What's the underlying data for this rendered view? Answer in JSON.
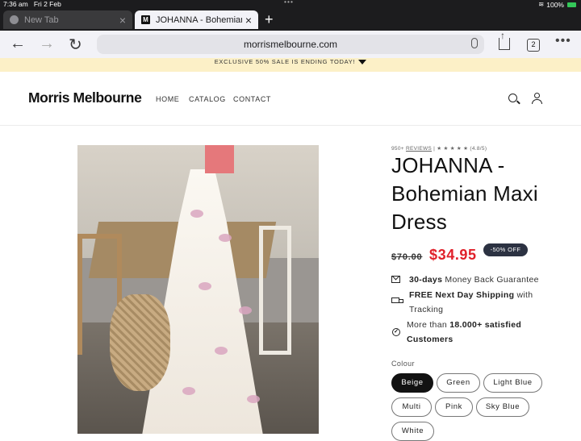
{
  "status": {
    "time": "7:36 am",
    "date": "Fri 2 Feb",
    "battery": "100%"
  },
  "tabs": [
    {
      "title": "New Tab"
    },
    {
      "title": "JOHANNA - Bohemian M",
      "favicon_letter": "M"
    }
  ],
  "toolbar": {
    "url": "morrismelbourne.com",
    "tab_count": "2"
  },
  "announcement": "EXCLUSIVE 50% SALE IS ENDING TODAY!",
  "header": {
    "logo": "Morris Melbourne",
    "nav": [
      "HOME",
      "CATALOG",
      "CONTACT"
    ]
  },
  "product": {
    "review_count": "950+",
    "reviews_link": "REVIEWS",
    "stars": "★ ★ ★ ★ ★",
    "rating": "(4.8/5)",
    "title": "JOHANNA - Bohemian Maxi Dress",
    "compare_price": "$70.00",
    "sale_price": "$34.95",
    "discount_badge": "-50% OFF",
    "benefits": {
      "money_back_bold": "30-days",
      "money_back_rest": " Money Back Guarantee",
      "shipping_bold": "FREE Next Day Shipping",
      "shipping_rest": " with Tracking",
      "customers_pre": "More than ",
      "customers_bold": "18.000+ satisfied Customers"
    },
    "color_label": "Colour",
    "colors": [
      "Beige",
      "Green",
      "Light Blue",
      "Multi",
      "Pink",
      "Sky Blue",
      "White"
    ],
    "selected_color": "Beige"
  },
  "colors": {
    "sale_red": "#e0202a",
    "badge_bg": "#2c3242",
    "announcement_bg": "#fcf0c7"
  }
}
